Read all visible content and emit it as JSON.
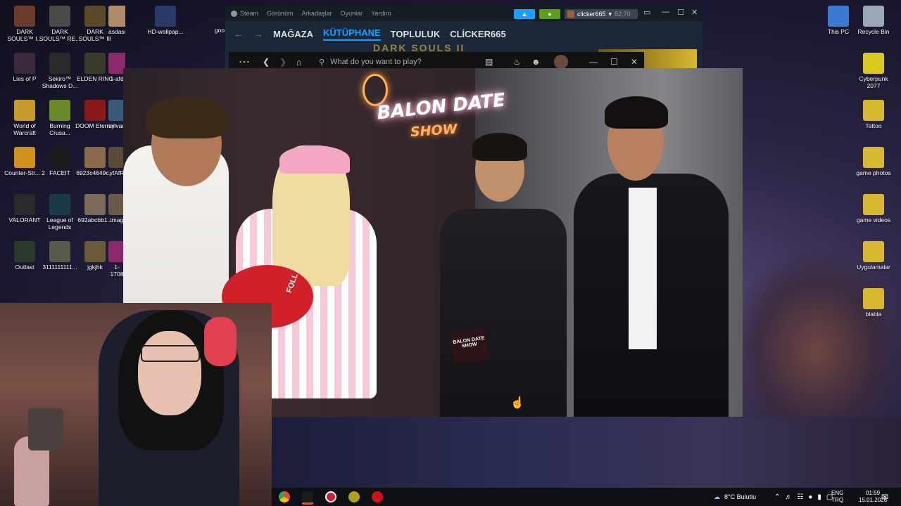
{
  "desktop": {
    "left_icons": [
      {
        "label": "DARK SOULS™ I...",
        "color": "#6a3a2a"
      },
      {
        "label": "DARK SOULS™ RE...",
        "color": "#4a4a4a"
      },
      {
        "label": "DARK SOULS™ III",
        "color": "#5a4a2a"
      },
      {
        "label": "asdasdasd...",
        "color": "#b08a6a"
      },
      {
        "label": "HD-wallpap...",
        "color": "#2a3a6a"
      },
      {
        "label": "Lies of P",
        "color": "#3a2a3a"
      },
      {
        "label": "Sekiro™ Shadows D...",
        "color": "#2a2a2a"
      },
      {
        "label": "ELDEN RING",
        "color": "#3a3a2a"
      },
      {
        "label": "1-afd",
        "color": "#8a2a6a"
      },
      {
        "label": "World of Warcraft",
        "color": "#c89a2a"
      },
      {
        "label": "Burning Crusa...",
        "color": "#6a8a2a"
      },
      {
        "label": "DOOM Eternal",
        "color": "#8a1a1a"
      },
      {
        "label": "sylvan",
        "color": "#3a5a7a"
      },
      {
        "label": "Counter-Str... 2",
        "color": "#d0901a"
      },
      {
        "label": "FACEIT",
        "color": "#1a1a1a"
      },
      {
        "label": "6923c4649c...",
        "color": "#8a6a4a"
      },
      {
        "label": "yfAfR",
        "color": "#5a4a3a"
      },
      {
        "label": "VALORANT",
        "color": "#2a2a2a"
      },
      {
        "label": "League of Legends",
        "color": "#1a3a4a"
      },
      {
        "label": "692abcbb1...",
        "color": "#7a6a5a"
      },
      {
        "label": "imag",
        "color": "#6a5a4a"
      },
      {
        "label": "Outlast",
        "color": "#2a3a2a"
      },
      {
        "label": "3111111111...",
        "color": "#5a5a4a"
      },
      {
        "label": "jgkjhk",
        "color": "#6a5a3a"
      },
      {
        "label": "1-1708",
        "color": "#8a2a6a"
      }
    ],
    "right_icons": [
      {
        "label": "This PC",
        "color": "#3a7ad0"
      },
      {
        "label": "Recycle Bin",
        "color": "#9aa8b8"
      },
      {
        "label": "Cyberpunk 2077",
        "color": "#d8c820"
      },
      {
        "label": "Tattoo",
        "color": "#d8b830"
      },
      {
        "label": "game photos",
        "color": "#d8b830"
      },
      {
        "label": "game videos",
        "color": "#d8b830"
      },
      {
        "label": "Uygulamalar",
        "color": "#d8b830"
      },
      {
        "label": "blabla",
        "color": "#d8b830"
      }
    ],
    "partial_label": "goo"
  },
  "steam": {
    "menu": [
      "Steam",
      "Görünüm",
      "Arkadaşlar",
      "Oyunlar",
      "Yardım"
    ],
    "nav": [
      "MAĞAZA",
      "KÜTÜPHANE",
      "TOPLULUK",
      "CLİCKER665"
    ],
    "active_nav": "KÜTÜPHANE",
    "user": "clicker665",
    "balance": "52,70",
    "banner_text": "DARK SOULS II"
  },
  "app": {
    "search_placeholder": "What do you want to play?"
  },
  "video": {
    "neon_title": "BALON DATE",
    "neon_sub": "SHOW",
    "sign_text": "BALON DATE SHOW",
    "balloon_text": "FOLL"
  },
  "taskbar": {
    "weather": "8°C Bulutlu",
    "lang_top": "ENG",
    "lang_bottom": "TRQ",
    "time": "01:59",
    "date": "15.01.2026"
  },
  "colors": {
    "steam_accent": "#1a9fff",
    "steam_bg": "#1b2838",
    "neon_pink": "#ff80b0",
    "neon_orange": "#ffb060"
  }
}
